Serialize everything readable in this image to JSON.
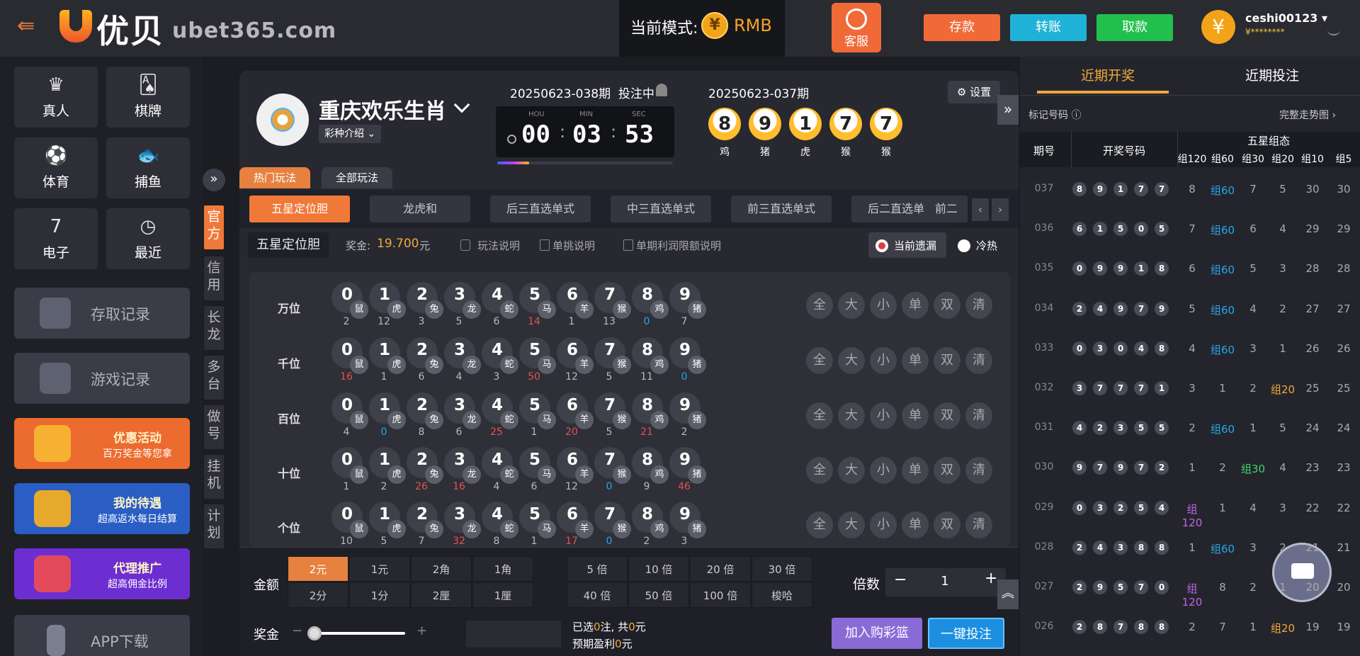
{
  "header": {
    "logo_cn": "优贝",
    "logo_en": "ubet365.com",
    "mode_label": "当前模式:",
    "mode_value": "RMB",
    "coin_symbol": "¥",
    "service": "客服",
    "deposit": "存款",
    "transfer": "转账",
    "withdraw": "取款",
    "username": "ceshi00123",
    "balance": "¥********",
    "avatar_symbol": "¥"
  },
  "sidebar": {
    "tiles": [
      {
        "label": "真人",
        "icon": "dealer-icon"
      },
      {
        "label": "棋牌",
        "icon": "cards-icon"
      },
      {
        "label": "体育",
        "icon": "soccer-icon"
      },
      {
        "label": "捕鱼",
        "icon": "fish-icon"
      },
      {
        "label": "电子",
        "icon": "slots-icon"
      },
      {
        "label": "最近",
        "icon": "clock-icon"
      }
    ],
    "records": [
      "存取记录",
      "游戏记录"
    ],
    "promos": [
      {
        "t1": "优惠活动",
        "t2": "百万奖金等您拿",
        "color": "#ec6b2e"
      },
      {
        "t1": "我的待遇",
        "t2": "超高返水每日结算",
        "color": "#2a5ec4"
      },
      {
        "t1": "代理推广",
        "t2": "超高佣金比例",
        "color": "#6d2ed1"
      }
    ],
    "app": "APP下载"
  },
  "mode_tabs": [
    "官方",
    "信用",
    "长龙",
    "多台",
    "做号",
    "挂机",
    "计划"
  ],
  "game": {
    "title": "重庆欢乐生肖",
    "intro": "彩种介绍",
    "current_issue": "20250623-038期",
    "status": "投注中",
    "timer_labels": [
      "HOU",
      "MIN",
      "SEC"
    ],
    "timer": [
      "00",
      "03",
      "53"
    ],
    "timer_progress": 0.18,
    "last_issue": "20250623-037期",
    "last_balls": [
      "8",
      "9",
      "1",
      "7",
      "7"
    ],
    "last_zodiac": [
      "鸡",
      "猪",
      "虎",
      "猴",
      "猴"
    ],
    "settings": "设置"
  },
  "play_tabs": [
    "热门玩法",
    "全部玩法"
  ],
  "sub_tabs": [
    "五星定位胆",
    "龙虎和",
    "后三直选单式",
    "中三直选单式",
    "前三直选单式",
    "后二直选单式",
    "前二"
  ],
  "info": {
    "name": "五星定位胆",
    "prize_label": "奖金:",
    "prize_value": "19.700",
    "unit": "元",
    "links": [
      "玩法说明",
      "单挑说明",
      "单期利润限额说明"
    ],
    "toggle_a": "当前遗漏",
    "toggle_b": "冷热"
  },
  "zodiac": [
    "鼠",
    "虎",
    "兔",
    "龙",
    "蛇",
    "马",
    "羊",
    "猴",
    "鸡",
    "猪"
  ],
  "digits": [
    "0",
    "1",
    "2",
    "3",
    "4",
    "5",
    "6",
    "7",
    "8",
    "9"
  ],
  "rows": [
    {
      "label": "万位",
      "miss": [
        "2",
        "12",
        "3",
        "5",
        "6",
        "14",
        "1",
        "13",
        "0",
        "7"
      ]
    },
    {
      "label": "千位",
      "miss": [
        "16",
        "1",
        "6",
        "4",
        "3",
        "50",
        "12",
        "5",
        "11",
        "0"
      ]
    },
    {
      "label": "百位",
      "miss": [
        "4",
        "0",
        "8",
        "6",
        "25",
        "1",
        "20",
        "5",
        "21",
        "2"
      ]
    },
    {
      "label": "十位",
      "miss": [
        "1",
        "2",
        "26",
        "16",
        "4",
        "6",
        "12",
        "0",
        "9",
        "46"
      ]
    },
    {
      "label": "个位",
      "miss": [
        "10",
        "5",
        "7",
        "32",
        "8",
        "1",
        "17",
        "0",
        "2",
        "3"
      ]
    }
  ],
  "quick": [
    "全",
    "大",
    "小",
    "单",
    "双",
    "清"
  ],
  "bottom": {
    "amount_label": "金额",
    "amounts": [
      "2元",
      "1元",
      "2角",
      "1角",
      "2分",
      "1分",
      "2厘",
      "1厘"
    ],
    "mults": [
      "5 倍",
      "10 倍",
      "20 倍",
      "30 倍",
      "40 倍",
      "50 倍",
      "100 倍",
      "梭哈"
    ],
    "mult_label": "倍数",
    "mult_value": "1",
    "prize_label": "奖金",
    "sel_a": "已选",
    "sel_n": "0",
    "sel_b": "注, 共",
    "sel_amt": "0",
    "sel_c": "元",
    "profit_a": "预期盈利",
    "profit_v": "0",
    "profit_c": "元",
    "cart": "加入购彩篮",
    "bet": "一键投注",
    "minus": "−",
    "plus": "+"
  },
  "right": {
    "tabs": [
      "近期开奖",
      "近期投注"
    ],
    "mark": "标记号码",
    "trend": "完整走势图",
    "h_issue": "期号",
    "h_nums": "开奖号码",
    "h_group": "五星组态",
    "h_cols": [
      "组120",
      "组60",
      "组30",
      "组20",
      "组10",
      "组5"
    ],
    "rows": [
      {
        "p": "037",
        "n": [
          "8",
          "9",
          "1",
          "7",
          "7"
        ],
        "z": [
          "8",
          "组60",
          "7",
          "5",
          "30",
          "30"
        ]
      },
      {
        "p": "036",
        "n": [
          "6",
          "1",
          "5",
          "0",
          "5"
        ],
        "z": [
          "7",
          "组60",
          "6",
          "4",
          "29",
          "29"
        ]
      },
      {
        "p": "035",
        "n": [
          "0",
          "9",
          "9",
          "1",
          "8"
        ],
        "z": [
          "6",
          "组60",
          "5",
          "3",
          "28",
          "28"
        ]
      },
      {
        "p": "034",
        "n": [
          "2",
          "4",
          "9",
          "7",
          "9"
        ],
        "z": [
          "5",
          "组60",
          "4",
          "2",
          "27",
          "27"
        ]
      },
      {
        "p": "033",
        "n": [
          "0",
          "3",
          "0",
          "4",
          "8"
        ],
        "z": [
          "4",
          "组60",
          "3",
          "1",
          "26",
          "26"
        ]
      },
      {
        "p": "032",
        "n": [
          "3",
          "7",
          "7",
          "7",
          "1"
        ],
        "z": [
          "3",
          "1",
          "2",
          "组20",
          "25",
          "25"
        ]
      },
      {
        "p": "031",
        "n": [
          "4",
          "2",
          "3",
          "5",
          "5"
        ],
        "z": [
          "2",
          "组60",
          "1",
          "5",
          "24",
          "24"
        ]
      },
      {
        "p": "030",
        "n": [
          "9",
          "7",
          "9",
          "7",
          "2"
        ],
        "z": [
          "1",
          "2",
          "组30",
          "4",
          "23",
          "23"
        ]
      },
      {
        "p": "029",
        "n": [
          "0",
          "3",
          "2",
          "5",
          "4"
        ],
        "z": [
          "组120",
          "1",
          "4",
          "3",
          "22",
          "22"
        ]
      },
      {
        "p": "028",
        "n": [
          "2",
          "4",
          "3",
          "8",
          "8"
        ],
        "z": [
          "1",
          "组60",
          "3",
          "2",
          "21",
          "21"
        ]
      },
      {
        "p": "027",
        "n": [
          "2",
          "9",
          "5",
          "7",
          "0"
        ],
        "z": [
          "组120",
          "8",
          "2",
          "1",
          "20",
          "20"
        ]
      },
      {
        "p": "026",
        "n": [
          "2",
          "8",
          "7",
          "8",
          "8"
        ],
        "z": [
          "2",
          "7",
          "1",
          "组20",
          "19",
          "19"
        ]
      }
    ]
  }
}
